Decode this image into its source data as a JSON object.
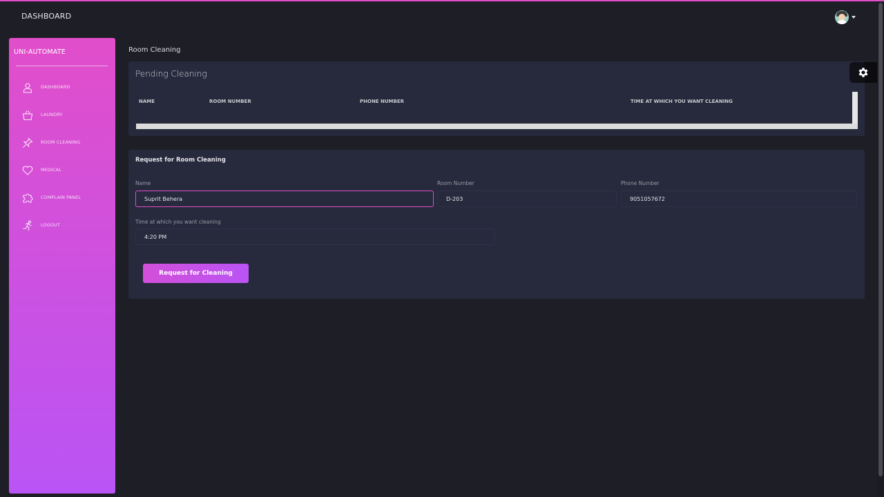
{
  "topbar": {
    "brand": "DASHBOARD"
  },
  "sidebar": {
    "logo": "UNI-AUTOMATE",
    "items": [
      {
        "label": "DASHBOARD",
        "icon": "user-icon"
      },
      {
        "label": "LAUNDRY",
        "icon": "basket-icon"
      },
      {
        "label": "ROOM CLEANING",
        "icon": "pin-icon"
      },
      {
        "label": "MEDICAL",
        "icon": "heart-icon"
      },
      {
        "label": "COMPLAIN PANEL",
        "icon": "puzzle-icon"
      },
      {
        "label": "LOGOUT",
        "icon": "run-icon"
      }
    ]
  },
  "breadcrumb": "Room Cleaning",
  "pending": {
    "title": "Pending Cleaning",
    "columns": [
      "NAME",
      "ROOM NUMBER",
      "PHONE NUMBER",
      "TIME AT WHICH YOU WANT CLEANING"
    ]
  },
  "request": {
    "title": "Request for Room Cleaning",
    "name_label": "Name",
    "name_value": "Suprit Behera",
    "room_label": "Room Number",
    "room_value": "D-203",
    "phone_label": "Phone Number",
    "phone_value": "9051057672",
    "time_label": "Time at which you want cleaning",
    "time_value": "4:20 PM",
    "submit_label": "Request for Cleaning"
  },
  "colors": {
    "accent": "#e14eca",
    "accent2": "#ba54f5",
    "card": "#27293d",
    "background": "#1e1e26"
  }
}
